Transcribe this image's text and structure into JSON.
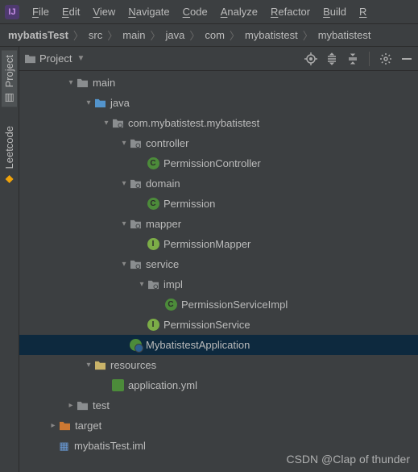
{
  "menubar": {
    "items": [
      "File",
      "Edit",
      "View",
      "Navigate",
      "Code",
      "Analyze",
      "Refactor",
      "Build",
      "R"
    ]
  },
  "breadcrumbs": [
    "mybatisTest",
    "src",
    "main",
    "java",
    "com",
    "mybatistest",
    "mybatistest"
  ],
  "sidebar": {
    "tabs": [
      {
        "label": "Project"
      },
      {
        "label": "Leetcode"
      }
    ]
  },
  "panel": {
    "title": "Project"
  },
  "tree": [
    {
      "d": 0,
      "arrow": "down",
      "icon": "folder",
      "text": "main"
    },
    {
      "d": 1,
      "arrow": "down",
      "icon": "folder-src",
      "text": "java"
    },
    {
      "d": 2,
      "arrow": "down",
      "icon": "package",
      "text": "com.mybatistest.mybatistest"
    },
    {
      "d": 3,
      "arrow": "down",
      "icon": "package",
      "text": "controller"
    },
    {
      "d": 4,
      "arrow": "",
      "icon": "class-c",
      "text": "PermissionController"
    },
    {
      "d": 3,
      "arrow": "down",
      "icon": "package",
      "text": "domain"
    },
    {
      "d": 4,
      "arrow": "",
      "icon": "class-c",
      "text": "Permission"
    },
    {
      "d": 3,
      "arrow": "down",
      "icon": "package",
      "text": "mapper"
    },
    {
      "d": 4,
      "arrow": "",
      "icon": "class-i",
      "text": "PermissionMapper"
    },
    {
      "d": 3,
      "arrow": "down",
      "icon": "package",
      "text": "service"
    },
    {
      "d": 4,
      "arrow": "down",
      "icon": "package",
      "text": "impl"
    },
    {
      "d": 5,
      "arrow": "",
      "icon": "class-c",
      "text": "PermissionServiceImpl"
    },
    {
      "d": 4,
      "arrow": "",
      "icon": "class-i",
      "text": "PermissionService"
    },
    {
      "d": 3,
      "arrow": "",
      "icon": "spring",
      "text": "MybatistestApplication",
      "selected": true
    },
    {
      "d": 1,
      "arrow": "down",
      "icon": "folder-res",
      "text": "resources"
    },
    {
      "d": 2,
      "arrow": "",
      "icon": "yml",
      "text": "application.yml"
    },
    {
      "d": 0,
      "arrow": "right",
      "icon": "folder",
      "text": "test"
    },
    {
      "d": -1,
      "arrow": "right",
      "icon": "folder-orange",
      "text": "target"
    },
    {
      "d": -1,
      "arrow": "",
      "icon": "iml",
      "text": "mybatisTest.iml"
    }
  ],
  "watermark": "CSDN @Clap of thunder"
}
